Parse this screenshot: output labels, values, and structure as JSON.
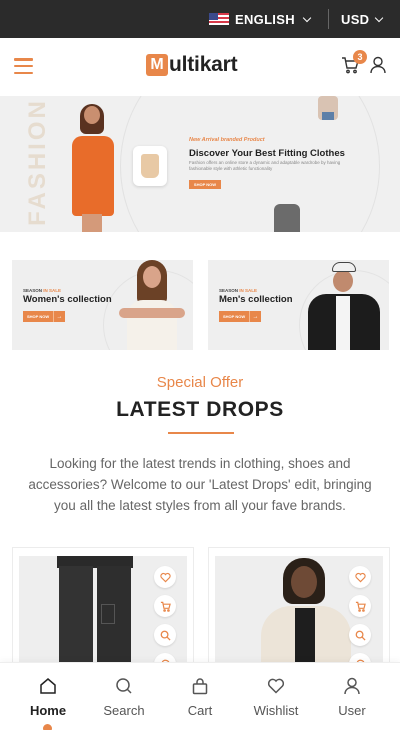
{
  "topbar": {
    "language": "ENGLISH",
    "currency": "USD",
    "flag_icon": "us-flag-icon"
  },
  "header": {
    "logo_letter": "M",
    "logo_text": "ultikart",
    "cart_count": "3"
  },
  "hero": {
    "tag": "New Arrival branded Product",
    "title": "Discover Your Best Fitting Clothes",
    "description": "Fashion offers an online store a dynamic and adaptable wardrobe by having fashionable style with athletic functionality",
    "button": "SHOP NOW",
    "side_word": "FASHION"
  },
  "collections": [
    {
      "tag_prefix": "SEASON",
      "tag_highlight": "IN SALE",
      "title": "Women's collection",
      "button": "SHOP NOW"
    },
    {
      "tag_prefix": "SEASON",
      "tag_highlight": "IN SALE",
      "title": "Men's collection",
      "button": "SHOP NOW"
    }
  ],
  "section": {
    "subtitle": "Special Offer",
    "title": "LATEST DROPS",
    "description": "Looking for the latest trends in clothing, shoes and accessories? Welcome to our 'Latest Drops' edit, bringing you all the latest styles from all your fave brands."
  },
  "products": [
    {
      "actions": [
        "heart-icon",
        "cart-icon",
        "search-icon",
        "refresh-icon"
      ]
    },
    {
      "actions": [
        "heart-icon",
        "cart-icon",
        "search-icon",
        "refresh-icon"
      ]
    }
  ],
  "bottom_nav": [
    {
      "label": "Home",
      "icon": "home-icon",
      "active": true
    },
    {
      "label": "Search",
      "icon": "search-icon",
      "active": false
    },
    {
      "label": "Cart",
      "icon": "bag-icon",
      "active": false
    },
    {
      "label": "Wishlist",
      "icon": "heart-icon",
      "active": false
    },
    {
      "label": "User",
      "icon": "user-icon",
      "active": false
    }
  ],
  "colors": {
    "accent": "#e8874a",
    "topbar": "#2b2b2b",
    "text": "#222222",
    "muted": "#666666"
  }
}
